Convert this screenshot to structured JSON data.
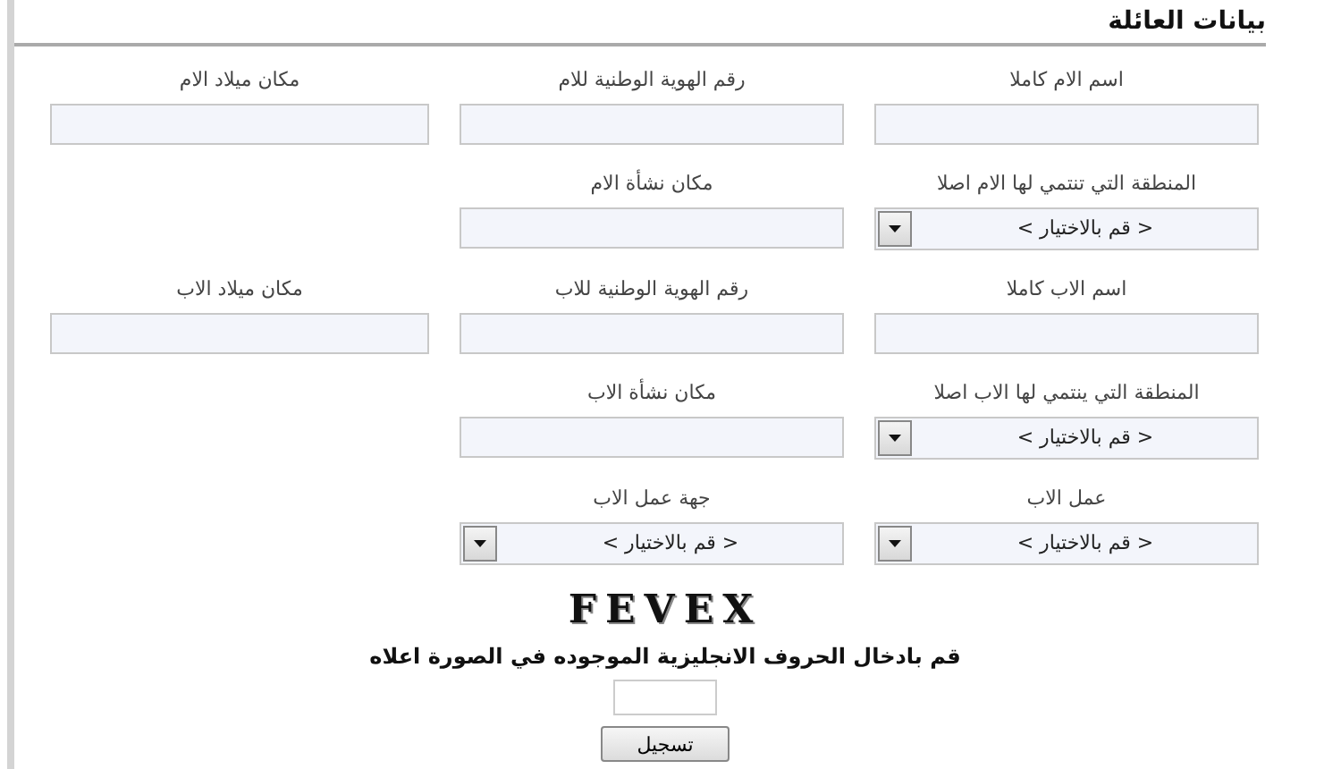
{
  "title": "بيانات العائلة",
  "rows": [
    {
      "fields": [
        {
          "label": "اسم الام كاملا",
          "kind": "text"
        },
        {
          "label": "رقم الهوية الوطنية للام",
          "kind": "text"
        },
        {
          "label": "مكان ميلاد الام",
          "kind": "text"
        }
      ]
    },
    {
      "fields": [
        {
          "label": "المنطقة التي تنتمي لها الام اصلا",
          "kind": "select",
          "value": "< قم بالاختيار >"
        },
        {
          "label": "مكان نشأة الام",
          "kind": "text"
        }
      ]
    },
    {
      "fields": [
        {
          "label": "اسم الاب كاملا",
          "kind": "text"
        },
        {
          "label": "رقم الهوية الوطنية للاب",
          "kind": "text"
        },
        {
          "label": "مكان ميلاد الاب",
          "kind": "text"
        }
      ]
    },
    {
      "fields": [
        {
          "label": "المنطقة التي ينتمي لها الاب اصلا",
          "kind": "select",
          "value": "< قم بالاختيار >"
        },
        {
          "label": "مكان نشأة الاب",
          "kind": "text"
        }
      ]
    },
    {
      "fields": [
        {
          "label": "عمل الاب",
          "kind": "select",
          "value": "< قم بالاختيار >"
        },
        {
          "label": "جهة عمل الاب",
          "kind": "select",
          "value": "< قم بالاختيار >"
        }
      ]
    }
  ],
  "captcha": {
    "code": "FEVEX",
    "instruction": "قم بادخال الحروف الانجليزية الموجوده في الصورة اعلاه"
  },
  "submit_button": "تسجيل"
}
